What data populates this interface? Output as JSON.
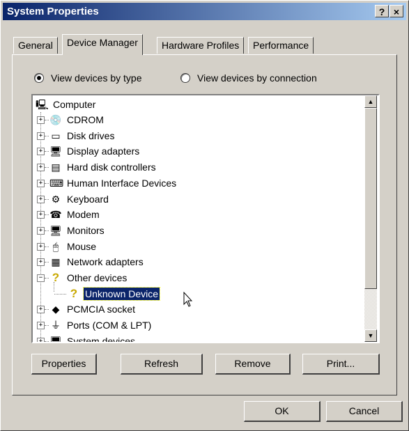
{
  "window": {
    "title": "System Properties",
    "help_label": "?",
    "close_label": "×"
  },
  "tabs": [
    {
      "label": "General"
    },
    {
      "label": "Device Manager"
    },
    {
      "label": "Hardware Profiles"
    },
    {
      "label": "Performance"
    }
  ],
  "active_tab": "Device Manager",
  "view_options": {
    "by_type": "View devices by type",
    "by_connection": "View devices by connection",
    "selected": "by_type"
  },
  "tree": {
    "root": "Computer",
    "items": [
      {
        "label": "CDROM",
        "icon": "cdrom-icon",
        "glyph": "💿",
        "expander": "+"
      },
      {
        "label": "Disk drives",
        "icon": "disk-drive-icon",
        "glyph": "▭",
        "expander": "+"
      },
      {
        "label": "Display adapters",
        "icon": "display-adapter-icon",
        "glyph": "🖥",
        "expander": "+"
      },
      {
        "label": "Hard disk controllers",
        "icon": "hard-disk-controller-icon",
        "glyph": "▤",
        "expander": "+"
      },
      {
        "label": "Human Interface Devices",
        "icon": "hid-icon",
        "glyph": "⌨",
        "expander": "+"
      },
      {
        "label": "Keyboard",
        "icon": "keyboard-icon",
        "glyph": "⚙",
        "expander": "+"
      },
      {
        "label": "Modem",
        "icon": "modem-icon",
        "glyph": "☎",
        "expander": "+"
      },
      {
        "label": "Monitors",
        "icon": "monitor-icon",
        "glyph": "🖥",
        "expander": "+"
      },
      {
        "label": "Mouse",
        "icon": "mouse-icon",
        "glyph": "🖱",
        "expander": "+"
      },
      {
        "label": "Network adapters",
        "icon": "network-adapter-icon",
        "glyph": "▦",
        "expander": "+"
      },
      {
        "label": "Other devices",
        "icon": "question-icon",
        "glyph": "?",
        "expander": "−"
      },
      {
        "label": "Unknown Device",
        "icon": "unknown-device-icon",
        "glyph": "?",
        "child": true,
        "selected": true
      },
      {
        "label": "PCMCIA socket",
        "icon": "pcmcia-icon",
        "glyph": "◆",
        "expander": "+"
      },
      {
        "label": "Ports (COM & LPT)",
        "icon": "port-icon",
        "glyph": "⏚",
        "expander": "+"
      },
      {
        "label": "System devices",
        "icon": "system-device-icon",
        "glyph": "🖥",
        "expander": "+"
      }
    ]
  },
  "actions": {
    "properties": "Properties",
    "refresh": "Refresh",
    "remove": "Remove",
    "print": "Print..."
  },
  "dialog": {
    "ok": "OK",
    "cancel": "Cancel"
  },
  "colors": {
    "title_start": "#0a246a",
    "title_end": "#a6caf0",
    "selection": "#0a246a",
    "face": "#d4d0c8"
  }
}
